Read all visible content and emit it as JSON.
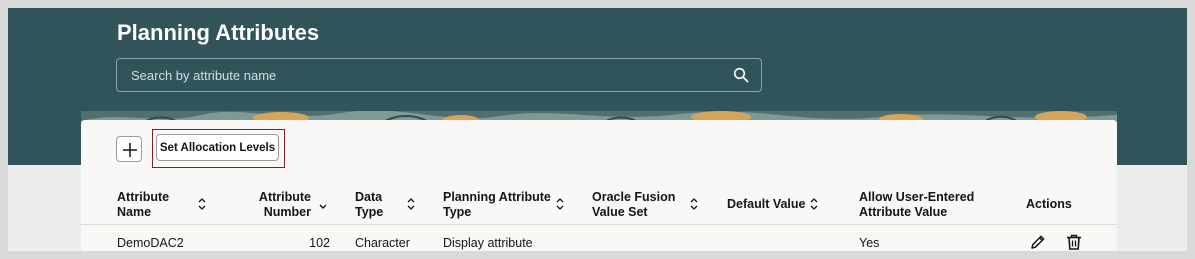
{
  "header": {
    "title": "Planning Attributes",
    "search_placeholder": "Search by attribute name"
  },
  "toolbar": {
    "add_icon": "plus-icon",
    "set_allocation_label": "Set Allocation Levels"
  },
  "table": {
    "columns": [
      {
        "line1": "Attribute",
        "line2": "Name",
        "sortable": true
      },
      {
        "line1": "Attribute",
        "line2": "Number",
        "sortable": true,
        "sort_state": "descending"
      },
      {
        "line1": "Data",
        "line2": "Type",
        "sortable": true
      },
      {
        "line1": "Planning Attribute",
        "line2": "Type",
        "sortable": true
      },
      {
        "line1": "Oracle Fusion",
        "line2": "Value Set",
        "sortable": true
      },
      {
        "line1": "Default Value",
        "line2": "",
        "sortable": true
      },
      {
        "line1": "Allow User-Entered",
        "line2": "Attribute Value",
        "sortable": false
      },
      {
        "line1": "Actions",
        "line2": "",
        "sortable": false
      }
    ],
    "rows": [
      {
        "attribute_name": "DemoDAC2",
        "attribute_number": "102",
        "data_type": "Character",
        "planning_attribute_type": "Display attribute",
        "oracle_fusion_value_set": "",
        "default_value": "",
        "allow_user_entered": "Yes",
        "actions": [
          "edit-icon",
          "delete-icon"
        ]
      }
    ]
  },
  "colors": {
    "banner": "#30545a",
    "card": "#f9f8f6",
    "highlight_border": "#8b1c1c"
  }
}
